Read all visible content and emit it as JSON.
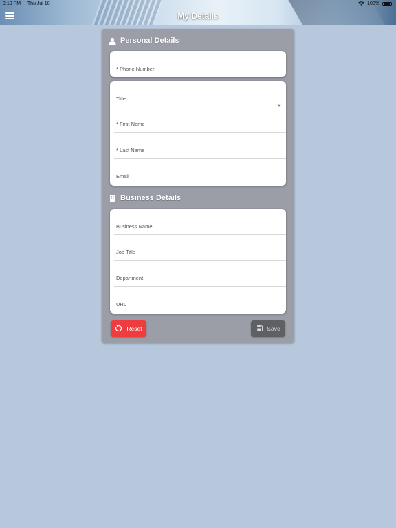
{
  "status_bar": {
    "time": "3:19 PM",
    "date": "Thu Jul 18",
    "battery": "100%"
  },
  "header": {
    "title": "My Details"
  },
  "personal": {
    "title": "Personal Details",
    "phone": "* Phone Number",
    "fields": [
      "Title",
      "* First Name",
      "* Last Name",
      "Email"
    ]
  },
  "business": {
    "title": "Business Details",
    "fields": [
      "Business Name",
      "Job Title",
      "Department",
      "URL"
    ]
  },
  "buttons": {
    "reset": "Reset",
    "save": "Save"
  },
  "colors": {
    "reset": "#ef3d3f",
    "save": "#5e6064",
    "card": "#9b9ea6",
    "background": "#b7c8dc"
  }
}
